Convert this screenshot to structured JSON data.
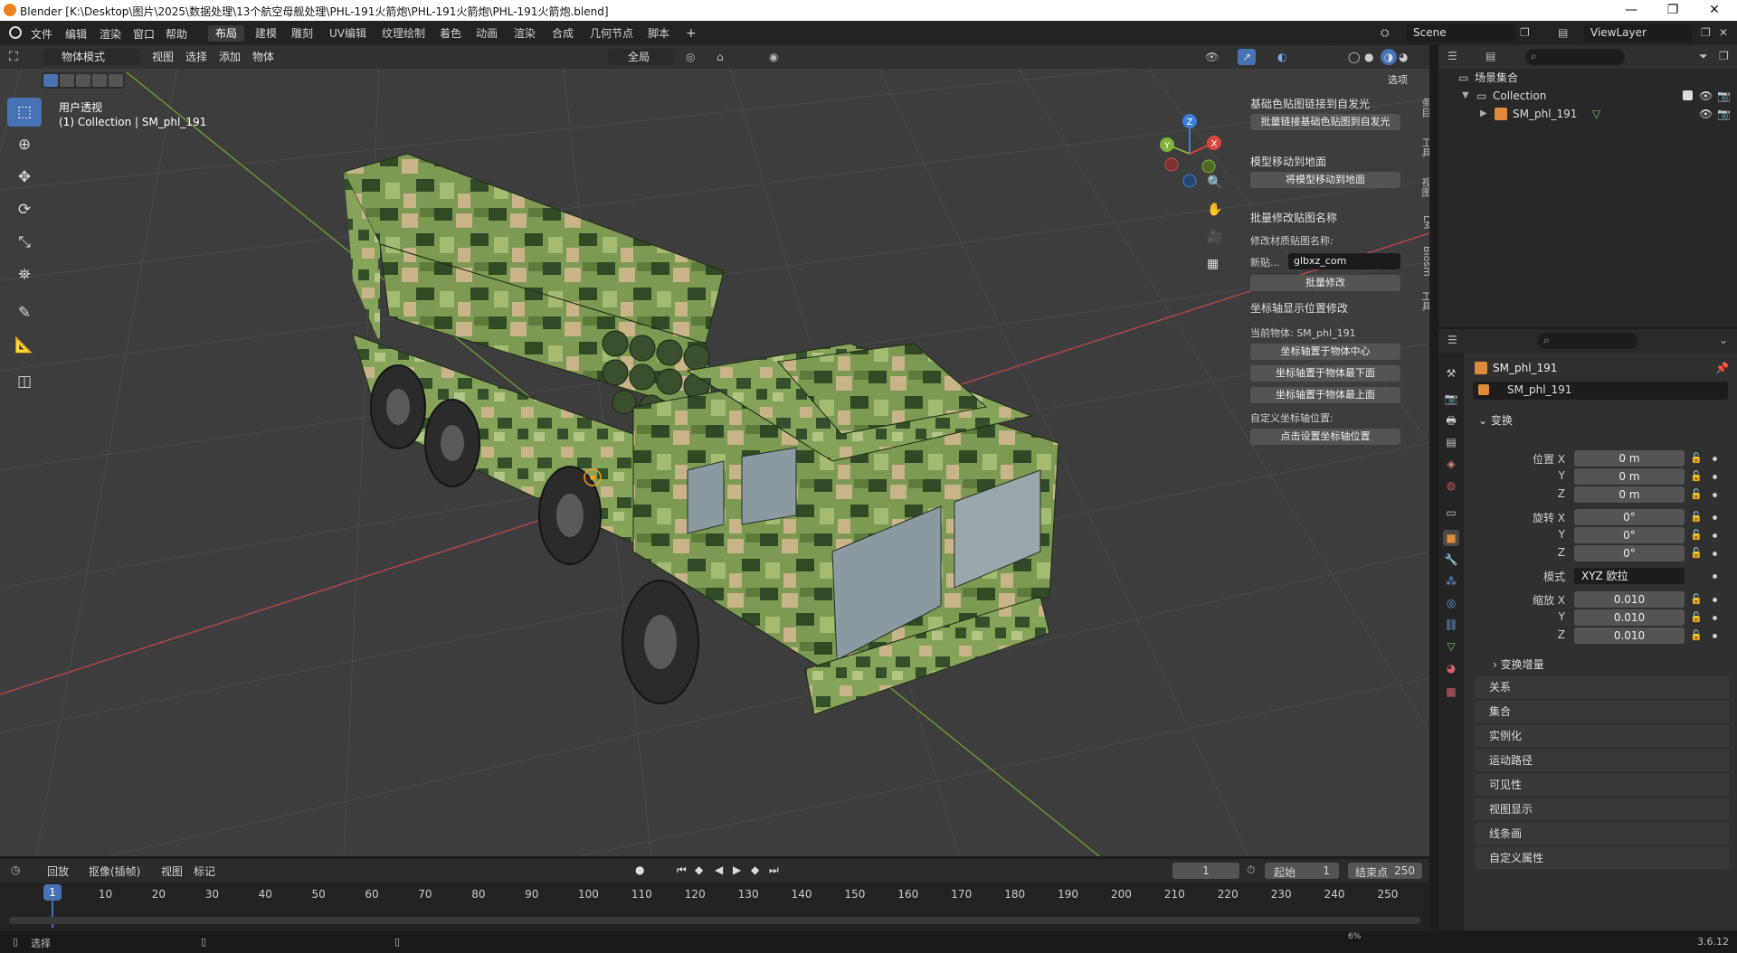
{
  "window": {
    "title": "Blender [K:\\Desktop\\图片\\2025\\数据处理\\13个航空母舰处理\\PHL-191火箭炮\\PHL-191火箭炮\\PHL-191火箭炮.blend]",
    "minimize": "—",
    "maximize": "❐",
    "close": "✕"
  },
  "menubar": {
    "items": [
      "文件",
      "编辑",
      "渲染",
      "窗口",
      "帮助"
    ],
    "workspaces": [
      "布局",
      "建模",
      "雕刻",
      "UV编辑",
      "纹理绘制",
      "着色",
      "动画",
      "渲染",
      "合成",
      "几何节点",
      "脚本"
    ],
    "active_workspace": "布局",
    "add_tab": "+",
    "scene": "Scene",
    "view_layer": "ViewLayer"
  },
  "viewport": {
    "mode": "物体模式",
    "menus": [
      "视图",
      "选择",
      "添加",
      "物体"
    ],
    "transform_orientation": "全局",
    "options_label": "选项",
    "view_name": "用户透视",
    "view_info": "(1) Collection | SM_phl_191",
    "gizmo": {
      "x": "X",
      "y": "Y",
      "z": "Z"
    }
  },
  "npanel": {
    "sections": [
      {
        "title": "基础色贴图链接到自发光",
        "button": "批量链接基础色贴图到自发光"
      },
      {
        "title": "模型移动到地面",
        "button": "将模型移动到地面"
      },
      {
        "title": "批量修改贴图名称",
        "label": "修改材质贴图名称:",
        "field_label": "新贴...",
        "field_value": "glbxz_com",
        "button": "批量修改"
      },
      {
        "title": "坐标轴显示位置修改",
        "current_object": "当前物体: SM_phl_191",
        "buttons": [
          "坐标轴置于物体中心",
          "坐标轴置于物体最下面",
          "坐标轴置于物体最上面"
        ],
        "custom_label": "自定义坐标轴位置:",
        "custom_button": "点击设置坐标轴位置"
      }
    ],
    "tabs": [
      "条目",
      "工具",
      "视图",
      "LM",
      "Blosm",
      "工具"
    ]
  },
  "outliner": {
    "root": "场景集合",
    "collection": "Collection",
    "object": "SM_phl_191"
  },
  "properties": {
    "object_name": "SM_phl_191",
    "data_name": "SM_phl_191",
    "transform_title": "变换",
    "location_label": "位置 X",
    "location": [
      "0 m",
      "0 m",
      "0 m"
    ],
    "rotation_label": "旋转 X",
    "rotation": [
      "0°",
      "0°",
      "0°"
    ],
    "axis_labels": [
      "Y",
      "Z"
    ],
    "mode_label": "模式",
    "mode_value": "XYZ 欧拉",
    "scale_label": "缩放 X",
    "scale": [
      "0.010",
      "0.010",
      "0.010"
    ],
    "delta_transform": "变换增量",
    "panels": [
      "关系",
      "集合",
      "实例化",
      "运动路径",
      "可见性",
      "视图显示",
      "线条画",
      "自定义属性"
    ]
  },
  "timeline": {
    "menus": [
      "回放",
      "抠像(插帧)",
      "视图",
      "标记"
    ],
    "current_frame": "1",
    "start_label": "起始",
    "start": "1",
    "end_label": "结束点",
    "end": "250",
    "ruler": [
      "10",
      "20",
      "30",
      "40",
      "50",
      "60",
      "70",
      "80",
      "90",
      "100",
      "110",
      "120",
      "130",
      "140",
      "150",
      "160",
      "170",
      "180",
      "190",
      "200",
      "210",
      "220",
      "230",
      "240",
      "250"
    ],
    "playhead": "1"
  },
  "statusbar": {
    "left": "选择",
    "version": "3.6.12",
    "percent": "6%"
  },
  "colors": {
    "accent": "#4772b3",
    "x_axis": "#d9463f",
    "y_axis": "#7fb33a",
    "z_axis": "#3b7fd8"
  }
}
